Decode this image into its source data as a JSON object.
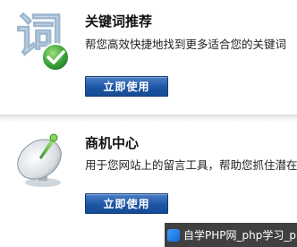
{
  "cards": [
    {
      "icon": "ci-character-checkmark-icon",
      "title": "关键词推荐",
      "description": "帮您高效快捷地找到更多适合您的关键词",
      "button_label": "立即使用"
    },
    {
      "icon": "satellite-dish-icon",
      "title": "商机中心",
      "description": "用于您网站上的留言工具，帮助您抓住潜在客",
      "button_label": "立即使用"
    }
  ],
  "watermark": {
    "text": "自学PHP网_php学习_php教"
  },
  "colors": {
    "button_blue": "#1e55a5",
    "check_green": "#3aa53a"
  }
}
